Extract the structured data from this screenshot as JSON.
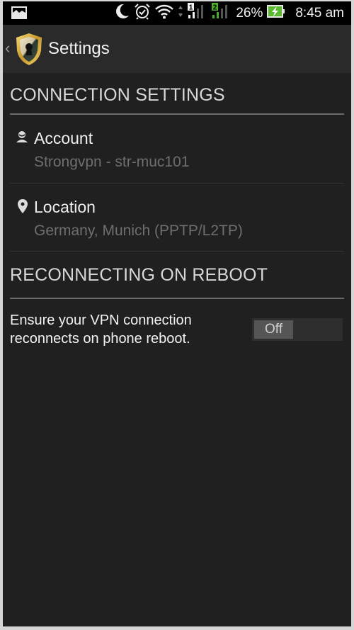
{
  "status_bar": {
    "left_icons": [
      "gallery-notification-icon"
    ],
    "right_icons": [
      "do-not-disturb-moon-icon",
      "alarm-icon",
      "wifi-icon",
      "data-arrows-icon",
      "sim1-signal-icon",
      "sim2-signal-icon",
      "battery-charging-icon"
    ],
    "sim1_label": "1",
    "sim2_label": "2",
    "battery_percent": "26%",
    "time": "8:45 am",
    "sim2_color": "#4caf2a",
    "battery_color": "#5cb82e"
  },
  "action_bar": {
    "back_glyph": "‹",
    "app_icon": "shield-keyhole-icon",
    "title": "Settings"
  },
  "sections": [
    {
      "header": "CONNECTION SETTINGS",
      "items": [
        {
          "icon": "person-icon",
          "title": "Account",
          "summary": "Strongvpn - str-muc101"
        },
        {
          "icon": "location-pin-icon",
          "title": "Location",
          "summary": "Germany, Munich (PPTP/L2TP)"
        }
      ]
    },
    {
      "header": "RECONNECTING ON REBOOT",
      "toggle_item": {
        "description": "Ensure your VPN connection reconnects on phone reboot.",
        "state_label": "Off",
        "enabled": false
      }
    }
  ]
}
